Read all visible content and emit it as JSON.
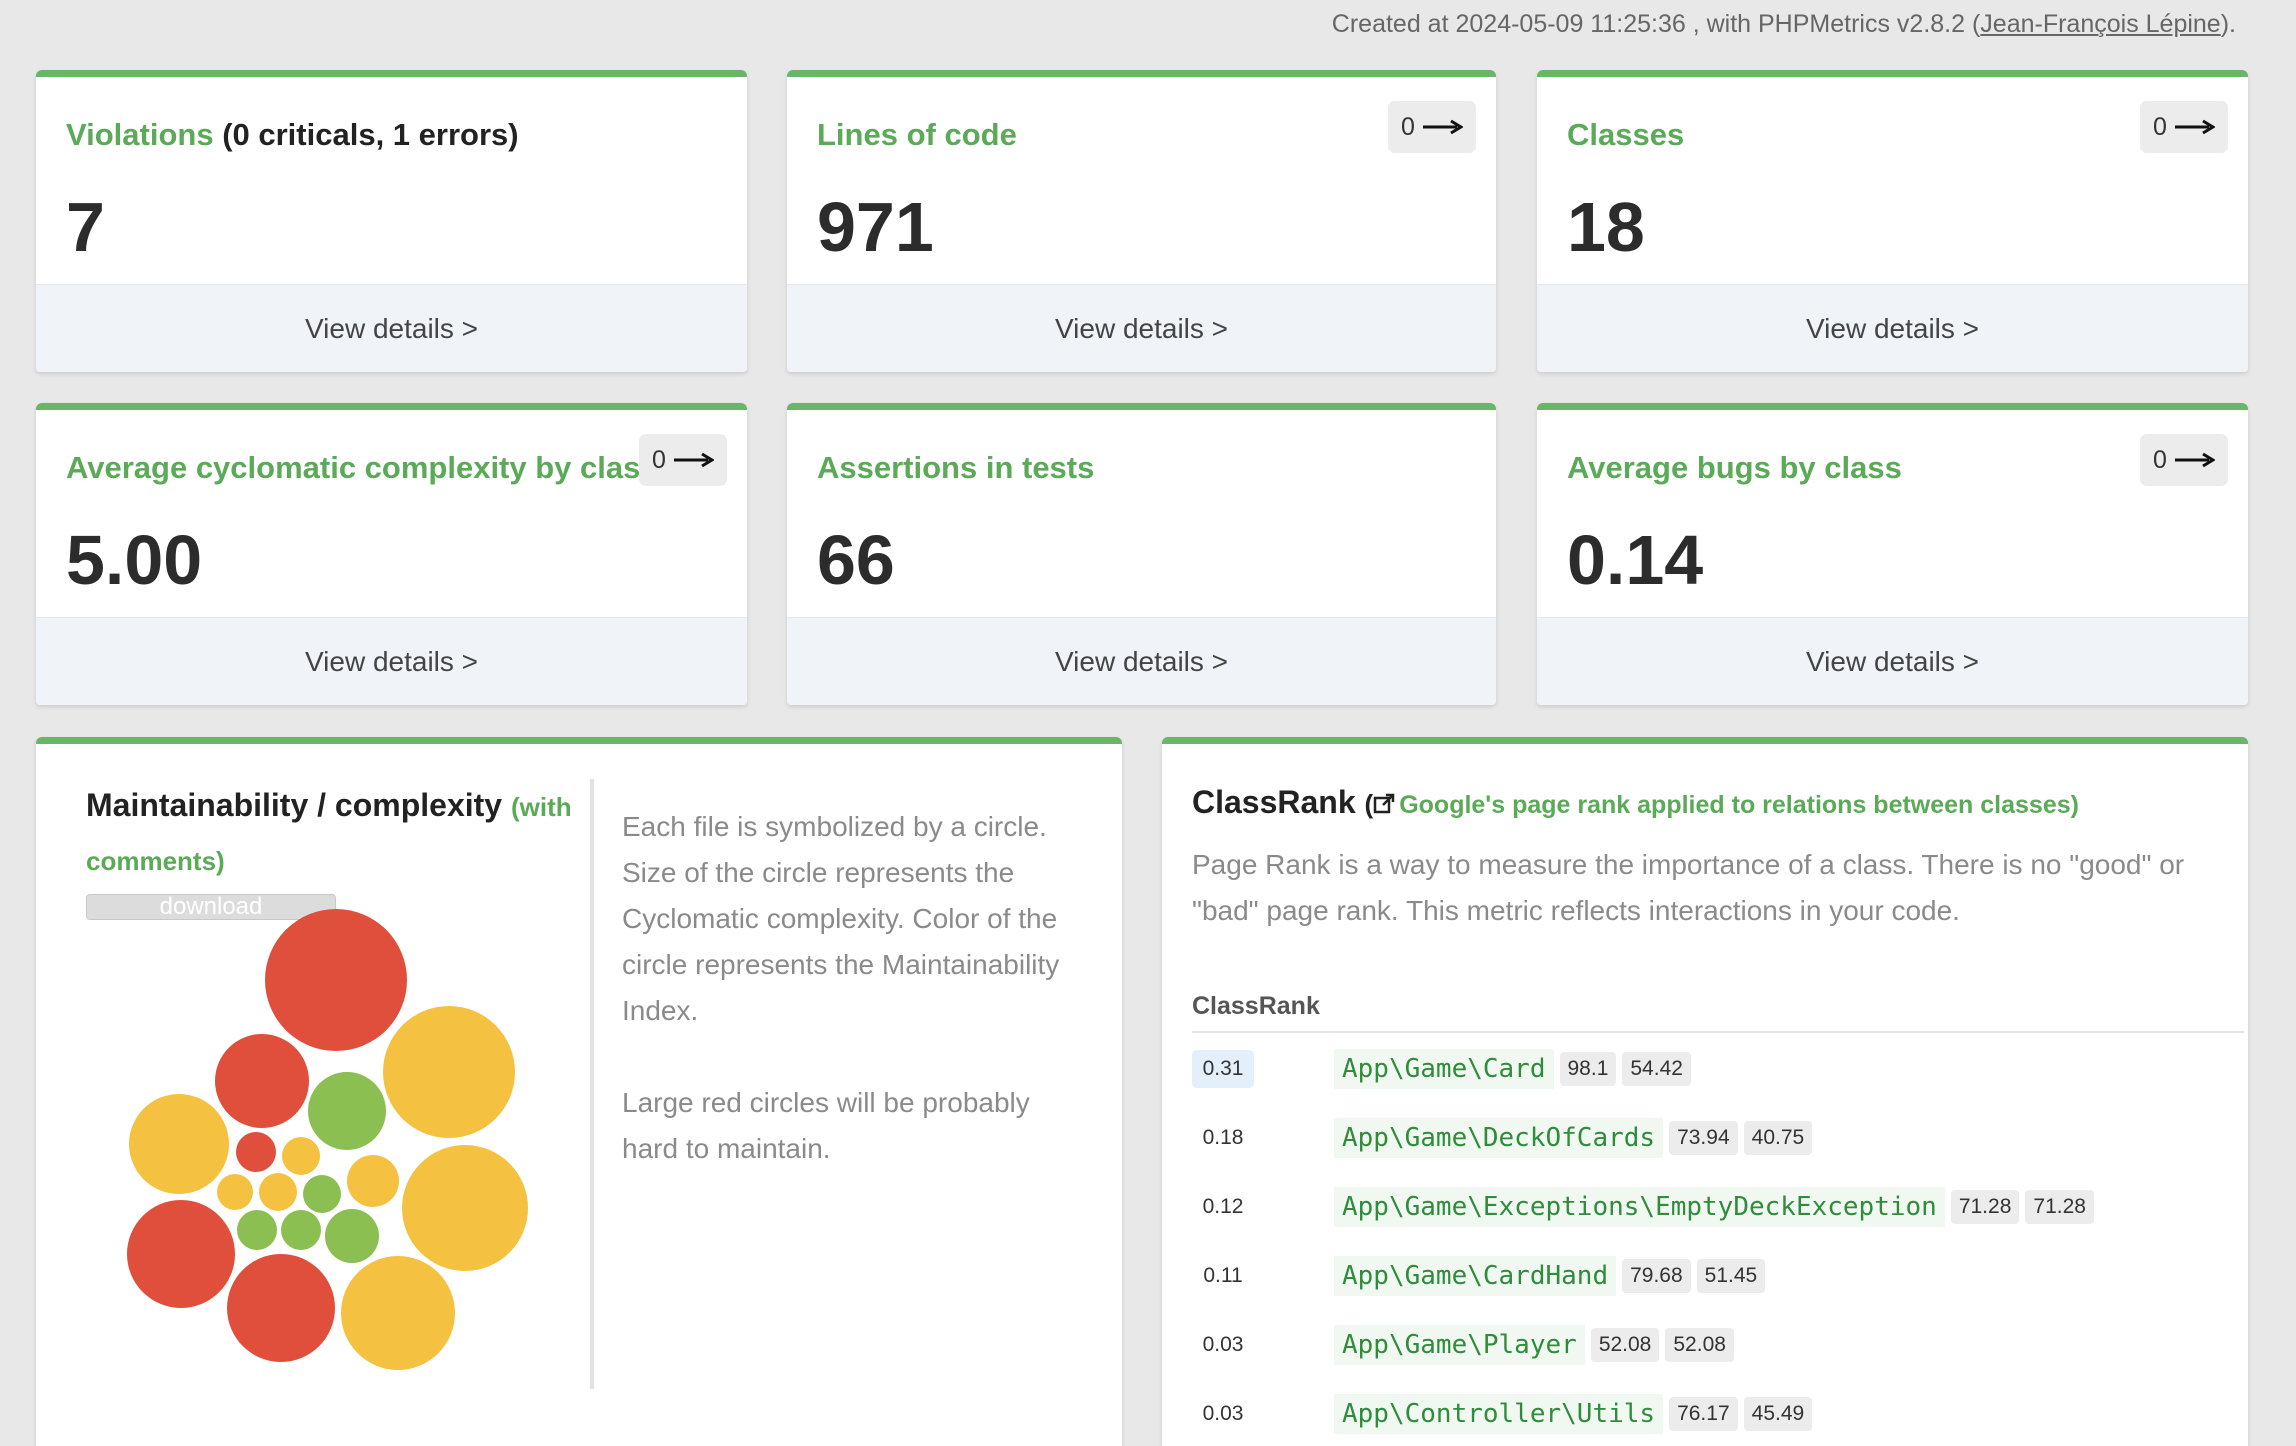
{
  "header": {
    "created_prefix": "Created at 2024-05-09 11:25:36 , with PHPMetrics v2.8.2 (",
    "author": "Jean-François Lépine",
    "created_suffix": ")."
  },
  "tiles": [
    {
      "title": "Violations",
      "title_suffix": "(0 criticals, 1 errors)",
      "value": "7",
      "footer": "View details >",
      "trend": null
    },
    {
      "title": "Lines of code",
      "value": "971",
      "footer": "View details >",
      "trend": "0"
    },
    {
      "title": "Classes",
      "value": "18",
      "footer": "View details >",
      "trend": "0"
    },
    {
      "title": "Average cyclomatic complexity by class",
      "value": "5.00",
      "footer": "View details >",
      "trend": "0"
    },
    {
      "title": "Assertions in tests",
      "value": "66",
      "footer": "View details >",
      "trend": null
    },
    {
      "title": "Average bugs by class",
      "value": "0.14",
      "footer": "View details >",
      "trend": "0"
    }
  ],
  "maintainability": {
    "title": "Maintainability / complexity",
    "title_note": "(with comments)",
    "download_label": "download",
    "description_1": "Each file is symbolized by a circle. Size of the circle represents the Cyclomatic complexity. Color of the circle represents the Maintainability Index.",
    "description_2": "Large red circles will be probably hard to maintain.",
    "colors": {
      "red": "#e04e3c",
      "yellow": "#f5c141",
      "green": "#8bbf52"
    }
  },
  "classrank": {
    "title": "ClassRank",
    "open_paren": "(",
    "link_text": "Google's page rank applied to relations between classes)",
    "description": "Page Rank is a way to measure the importance of a class. There is no \"good\" or \"bad\" page rank. This metric reflects interactions in your code.",
    "column_header": "ClassRank",
    "rows": [
      {
        "rank": "0.31",
        "name": "App\\Game\\Card",
        "m1": "98.1",
        "m2": "54.42"
      },
      {
        "rank": "0.18",
        "name": "App\\Game\\DeckOfCards",
        "m1": "73.94",
        "m2": "40.75"
      },
      {
        "rank": "0.12",
        "name": "App\\Game\\Exceptions\\EmptyDeckException",
        "m1": "71.28",
        "m2": "71.28"
      },
      {
        "rank": "0.11",
        "name": "App\\Game\\CardHand",
        "m1": "79.68",
        "m2": "51.45"
      },
      {
        "rank": "0.03",
        "name": "App\\Game\\Player",
        "m1": "52.08",
        "m2": "52.08"
      },
      {
        "rank": "0.03",
        "name": "App\\Controller\\Utils",
        "m1": "76.17",
        "m2": "45.49"
      }
    ]
  },
  "accent_color": "#6ab668"
}
